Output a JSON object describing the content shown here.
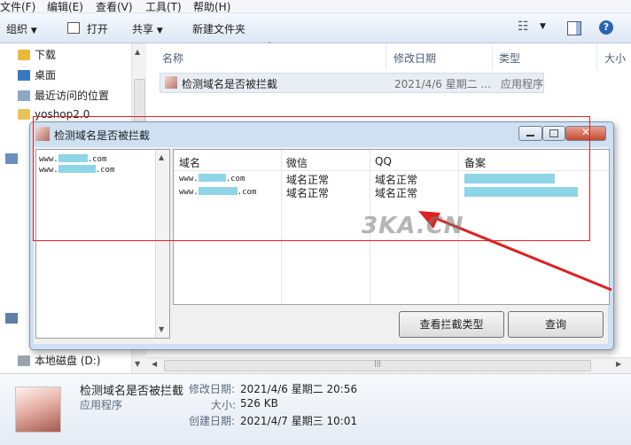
{
  "menu": [
    "文件(F)",
    "编辑(E)",
    "查看(V)",
    "工具(T)",
    "帮助(H)"
  ],
  "toolbar": {
    "organize": "组织",
    "open": "打开",
    "share": "共享",
    "new_folder": "新建文件夹"
  },
  "nav": {
    "items": [
      "下载",
      "桌面",
      "最近访问的位置",
      "yoshop2.0",
      "本地磁盘 (D:)"
    ]
  },
  "columns": [
    "名称",
    "修改日期",
    "类型",
    "大小"
  ],
  "file": {
    "name": "检测域名是否被拦截",
    "modified": "2021/4/6 星期二 ...",
    "type": "应用程序"
  },
  "details": {
    "name": "检测域名是否被拦截",
    "type": "应用程序",
    "modified_label": "修改日期:",
    "modified": "2021/4/6 星期二 20:56",
    "size_label": "大小:",
    "size": "526 KB",
    "created_label": "创建日期:",
    "created": "2021/4/7 星期三 10:01"
  },
  "dialog": {
    "title": "检测域名是否被拦截",
    "domains": [
      {
        "prefix": "www.",
        "suffix": ".com"
      },
      {
        "prefix": "www.",
        "suffix": ".com"
      }
    ],
    "headers": [
      "域名",
      "微信",
      "QQ",
      "备案"
    ],
    "rows": [
      {
        "prefix": "www.",
        "suffix": ".com",
        "wechat": "域名正常",
        "qq": "域名正常"
      },
      {
        "prefix": "www.",
        "suffix": ".com",
        "wechat": "域名正常",
        "qq": "域名正常"
      }
    ],
    "btn_types": "查看拦截类型",
    "btn_query": "查询"
  },
  "watermark": "3KA.CN",
  "colors": {
    "annotation": "#e02020",
    "mask": "#8fd5e8"
  }
}
